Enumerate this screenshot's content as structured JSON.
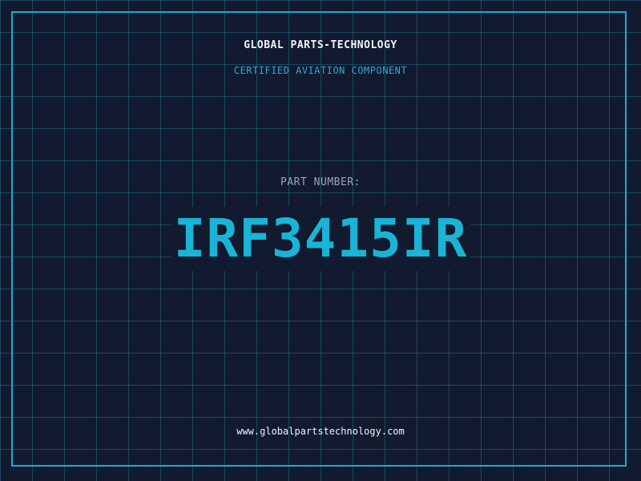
{
  "header": {
    "company": "GLOBAL PARTS-TECHNOLOGY",
    "tagline": "CERTIFIED AVIATION COMPONENT"
  },
  "part": {
    "label": "PART NUMBER:",
    "number": "IRF3415IR"
  },
  "footer": {
    "website": "www.globalpartstechnology.com"
  },
  "colors": {
    "background": "#111a2e",
    "grid": "#206e8c",
    "frame": "#1fa9cc",
    "accent": "#19b4d6",
    "text": "#f1f4f8",
    "muted": "#9aa6b8"
  }
}
